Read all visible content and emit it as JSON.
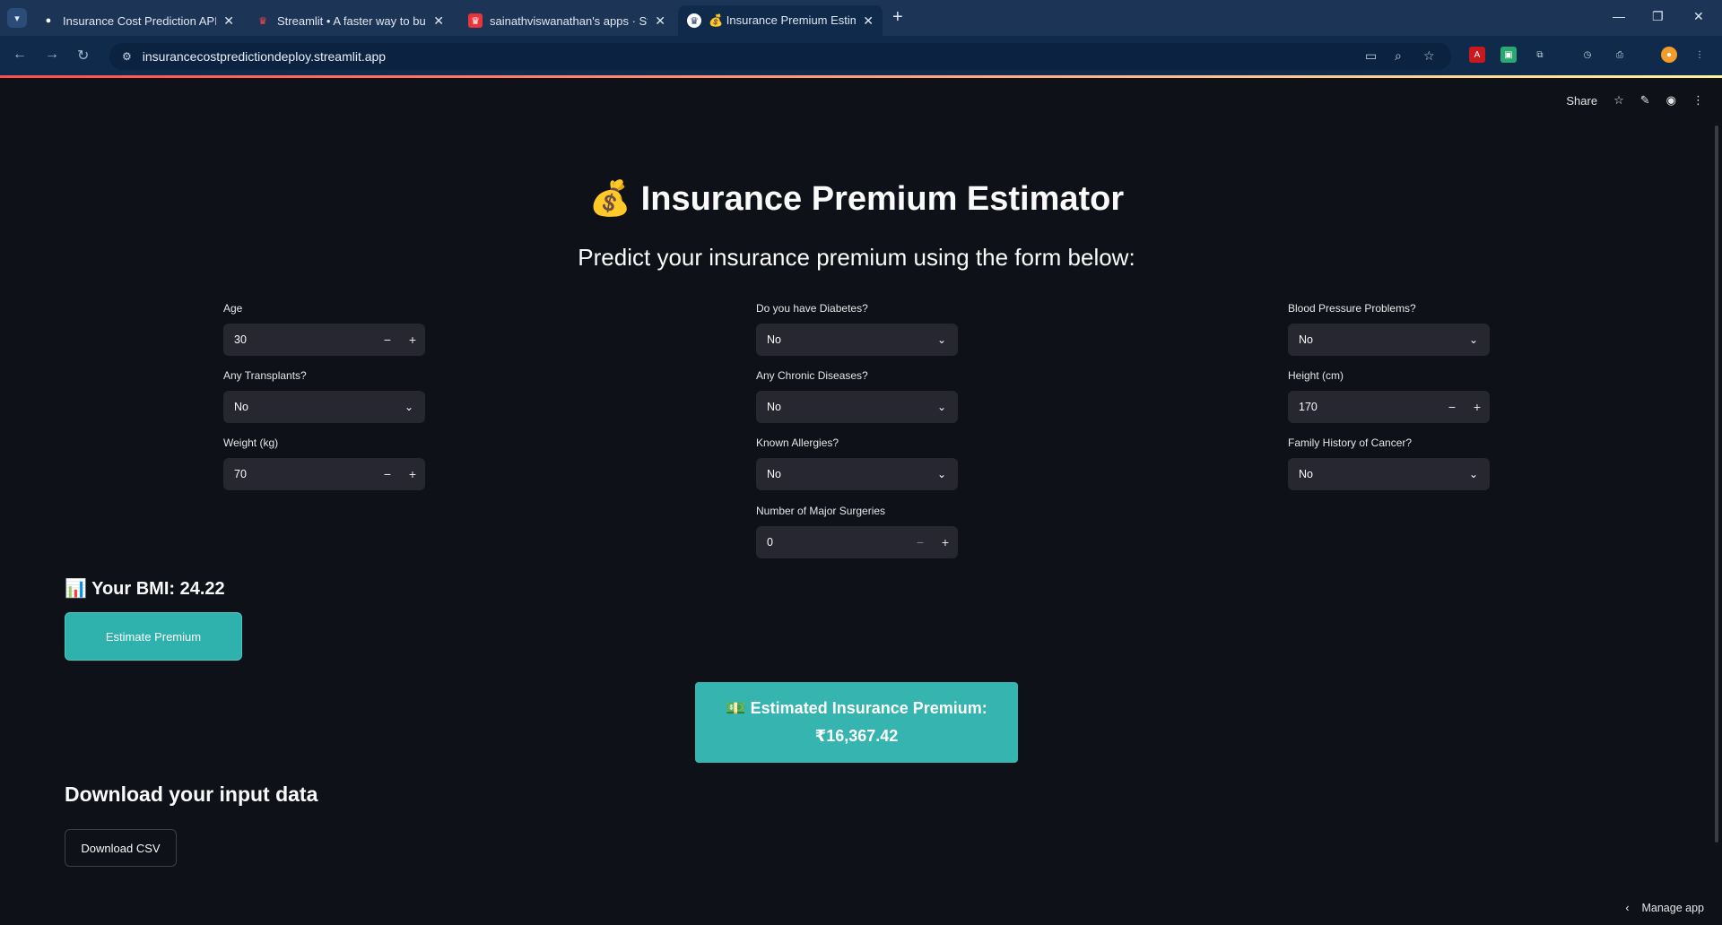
{
  "browser": {
    "tabs": [
      {
        "title": "Insurance Cost Prediction API -",
        "favicon": "api-icon",
        "color": "#ffffff"
      },
      {
        "title": "Streamlit • A faster way to build",
        "favicon": "streamlit-crown-icon",
        "color": "#ff4b4b"
      },
      {
        "title": "sainathviswanathan's apps · Stre",
        "favicon": "streamlit-apps-icon",
        "color": "#ff4b4b"
      },
      {
        "title": "💰 Insurance Premium Estimat",
        "favicon": "streamlit-crown-icon",
        "color": "#ffffff",
        "active": true
      }
    ],
    "url": "insurancecostpredictiondeploy.streamlit.app"
  },
  "toolbar": {
    "share_label": "Share"
  },
  "page": {
    "title": "💰 Insurance Premium Estimator",
    "subtitle": "Predict your insurance premium using the form below:"
  },
  "form": {
    "age": {
      "label": "Age",
      "value": "30"
    },
    "transplants": {
      "label": "Any Transplants?",
      "value": "No"
    },
    "weight": {
      "label": "Weight (kg)",
      "value": "70"
    },
    "diabetes": {
      "label": "Do you have Diabetes?",
      "value": "No"
    },
    "chronic": {
      "label": "Any Chronic Diseases?",
      "value": "No"
    },
    "allergies": {
      "label": "Known Allergies?",
      "value": "No"
    },
    "surgeries": {
      "label": "Number of Major Surgeries",
      "value": "0"
    },
    "bp": {
      "label": "Blood Pressure Problems?",
      "value": "No"
    },
    "height": {
      "label": "Height (cm)",
      "value": "170"
    },
    "cancer": {
      "label": "Family History of Cancer?",
      "value": "No"
    }
  },
  "bmi_text": "📊 Your BMI: 24.22",
  "estimate_button": "Estimate Premium",
  "result": {
    "label": "💵 Estimated Insurance Premium:",
    "value": "₹16,367.42"
  },
  "download": {
    "heading": "Download your input data",
    "button": "Download CSV"
  },
  "manage_app": "Manage app",
  "colors": {
    "background": "#0e1117",
    "input_bg": "#262730",
    "accent": "#2fb2ad"
  }
}
